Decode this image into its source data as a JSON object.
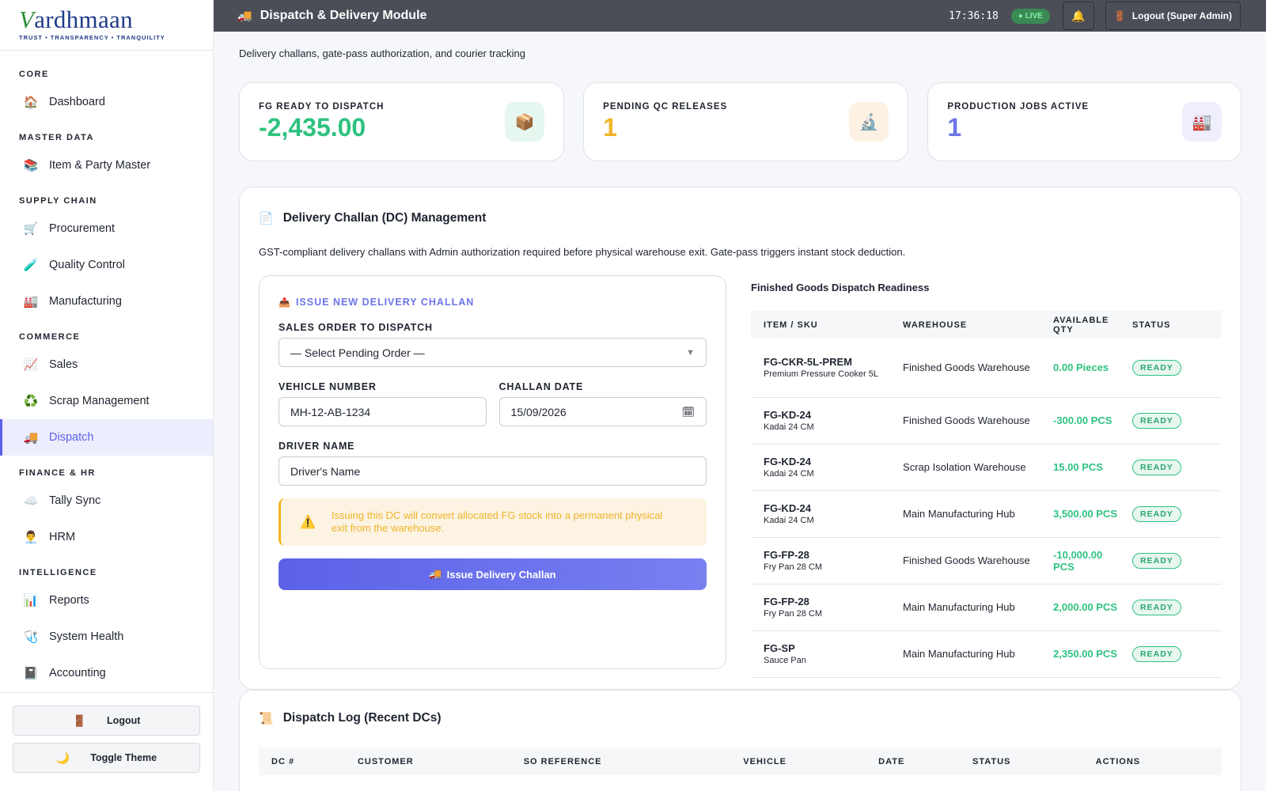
{
  "brand": {
    "name_initial": "V",
    "name_rest": "ardhmaan",
    "tagline": "TRUST • TRANSPARENCY • TRANQUILITY"
  },
  "sidebar": {
    "sections": [
      {
        "title": "CORE",
        "items": [
          {
            "label": "Dashboard",
            "icon": "home-icon",
            "glyph": "🏠"
          }
        ]
      },
      {
        "title": "MASTER DATA",
        "items": [
          {
            "label": "Item & Party Master",
            "icon": "books-icon",
            "glyph": "📚"
          }
        ]
      },
      {
        "title": "SUPPLY CHAIN",
        "items": [
          {
            "label": "Procurement",
            "icon": "cart-icon",
            "glyph": "🛒"
          },
          {
            "label": "Quality Control",
            "icon": "test-tube-icon",
            "glyph": "🧪"
          },
          {
            "label": "Manufacturing",
            "icon": "factory-icon",
            "glyph": "🏭"
          }
        ]
      },
      {
        "title": "COMMERCE",
        "items": [
          {
            "label": "Sales",
            "icon": "chart-up-icon",
            "glyph": "📈"
          },
          {
            "label": "Scrap Management",
            "icon": "recycle-icon",
            "glyph": "♻️"
          },
          {
            "label": "Dispatch",
            "icon": "truck-icon",
            "glyph": "🚚",
            "active": true
          }
        ]
      },
      {
        "title": "FINANCE & HR",
        "items": [
          {
            "label": "Tally Sync",
            "icon": "cloud-icon",
            "glyph": "☁️"
          },
          {
            "label": "HRM",
            "icon": "person-icon",
            "glyph": "👨‍💼"
          }
        ]
      },
      {
        "title": "INTELLIGENCE",
        "items": [
          {
            "label": "Reports",
            "icon": "bar-chart-icon",
            "glyph": "📊"
          },
          {
            "label": "System Health",
            "icon": "stethoscope-icon",
            "glyph": "🩺"
          },
          {
            "label": "Accounting",
            "icon": "ledger-icon",
            "glyph": "📓"
          }
        ]
      }
    ],
    "logout_label": "Logout",
    "theme_label": "Toggle Theme"
  },
  "topbar": {
    "title": "Dispatch & Delivery Module",
    "time": "17:36:18",
    "live": "LIVE",
    "logout": "Logout (Super Admin)"
  },
  "page": {
    "subtitle": "Delivery challans, gate-pass authorization, and courier tracking"
  },
  "stats": [
    {
      "label": "FG READY TO DISPATCH",
      "value": "-2,435.00",
      "color": "#2ec280",
      "icon": "package-icon",
      "glyph": "📦",
      "bg": "#e6f7ef"
    },
    {
      "label": "PENDING QC RELEASES",
      "value": "1",
      "color": "#f0b429",
      "icon": "microscope-icon",
      "glyph": "🔬",
      "bg": "#fdf1e4"
    },
    {
      "label": "PRODUCTION JOBS ACTIVE",
      "value": "1",
      "color": "#6d74e8",
      "icon": "factory-icon",
      "glyph": "🏭",
      "bg": "#eeeefd"
    }
  ],
  "dc_panel": {
    "title": "Delivery Challan (DC) Management",
    "description": "GST-compliant delivery challans with Admin authorization required before physical warehouse exit. Gate-pass triggers instant stock deduction.",
    "form": {
      "heading": "ISSUE NEW DELIVERY CHALLAN",
      "sales_order_label": "SALES ORDER TO DISPATCH",
      "sales_order_value": "— Select Pending Order —",
      "vehicle_label": "VEHICLE NUMBER",
      "vehicle_placeholder": "MH-12-AB-1234",
      "date_label": "CHALLAN DATE",
      "date_value": "15/09/2026",
      "driver_label": "DRIVER NAME",
      "driver_placeholder": "Driver's Name",
      "warning": "Issuing this DC will convert allocated FG stock into a permanent physical exit from the warehouse.",
      "submit": "Issue Delivery Challan"
    },
    "readiness": {
      "title": "Finished Goods Dispatch Readiness",
      "headers": [
        "ITEM / SKU",
        "WAREHOUSE",
        "AVAILABLE QTY",
        "STATUS"
      ],
      "rows": [
        {
          "sku": "FG-CKR-5L-PREM",
          "desc": "Premium Pressure Cooker 5L",
          "warehouse": "Finished Goods Warehouse",
          "qty": "0.00 Pieces",
          "status": "READY"
        },
        {
          "sku": "FG-KD-24",
          "desc": "Kadai 24 CM",
          "warehouse": "Finished Goods Warehouse",
          "qty": "-300.00 PCS",
          "status": "READY"
        },
        {
          "sku": "FG-KD-24",
          "desc": "Kadai 24 CM",
          "warehouse": "Scrap Isolation Warehouse",
          "qty": "15.00 PCS",
          "status": "READY"
        },
        {
          "sku": "FG-KD-24",
          "desc": "Kadai 24 CM",
          "warehouse": "Main Manufacturing Hub",
          "qty": "3,500.00 PCS",
          "status": "READY"
        },
        {
          "sku": "FG-FP-28",
          "desc": "Fry Pan 28 CM",
          "warehouse": "Finished Goods Warehouse",
          "qty": "-10,000.00 PCS",
          "status": "READY"
        },
        {
          "sku": "FG-FP-28",
          "desc": "Fry Pan 28 CM",
          "warehouse": "Main Manufacturing Hub",
          "qty": "2,000.00 PCS",
          "status": "READY"
        },
        {
          "sku": "FG-SP",
          "desc": "Sauce Pan",
          "warehouse": "Main Manufacturing Hub",
          "qty": "2,350.00 PCS",
          "status": "READY"
        }
      ]
    }
  },
  "log_panel": {
    "title": "Dispatch Log (Recent DCs)",
    "headers": [
      "DC #",
      "CUSTOMER",
      "SO REFERENCE",
      "VEHICLE",
      "DATE",
      "STATUS",
      "ACTIONS"
    ]
  }
}
